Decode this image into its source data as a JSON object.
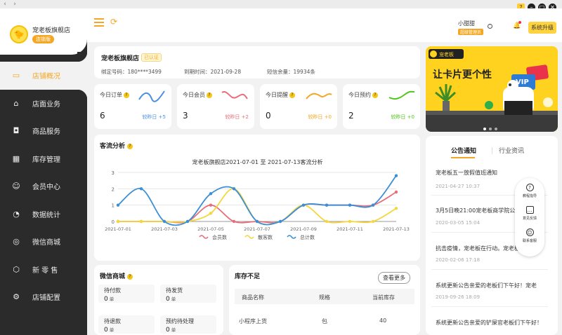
{
  "window": {
    "back": "‹",
    "forward": "›",
    "controls": [
      "?",
      "–",
      "▢",
      "✕"
    ]
  },
  "sidebar": {
    "store_name": "宠老板旗舰店",
    "badge": "连锁版",
    "items": [
      {
        "label": "店铺概况",
        "icon": "monitor-icon",
        "active": true
      },
      {
        "label": "店面业务",
        "icon": "house-icon"
      },
      {
        "label": "商品服务",
        "icon": "bag-icon"
      },
      {
        "label": "库存管理",
        "icon": "warehouse-icon"
      },
      {
        "label": "会员中心",
        "icon": "member-icon"
      },
      {
        "label": "数据统计",
        "icon": "chart-icon"
      },
      {
        "label": "微信商城",
        "icon": "wechat-icon"
      },
      {
        "label": "新 零 售",
        "icon": "box-icon"
      },
      {
        "label": "店铺配置",
        "icon": "gear-icon"
      }
    ]
  },
  "header": {
    "user_name": "小甜甜",
    "user_tag": "超级管理员",
    "upgrade": "系统升级"
  },
  "store": {
    "name": "宠老板旗舰店",
    "verified": "已认证",
    "phone": "绑定号码：180****3499",
    "expire": "到期时间：2021-09-28",
    "sms": "短信余量：19934条"
  },
  "stats": [
    {
      "label": "今日订单",
      "value": "6",
      "cmp_label": "较昨日",
      "cmp_value": "+5",
      "color": "#4a90e2"
    },
    {
      "label": "今日会员",
      "value": "3",
      "cmp_label": "较昨日",
      "cmp_value": "+2",
      "color": "#e86d7a"
    },
    {
      "label": "今日提醒",
      "value": "0",
      "cmp_label": "较昨日",
      "cmp_value": "+0",
      "color": "#f5a623"
    },
    {
      "label": "今日预约",
      "value": "2",
      "cmp_label": "较昨日",
      "cmp_value": "+0",
      "color": "#52c41a"
    }
  ],
  "traffic": {
    "title": "客流分析",
    "chart_title": "宠老板旗舰店2021-07-01 至 2021-07-13客流分析"
  },
  "chart_data": {
    "type": "line",
    "title": "宠老板旗舰店2021-07-01 至 2021-07-13客流分析",
    "x": [
      "2021-07-01",
      "2021-07-02",
      "2021-07-03",
      "2021-07-04",
      "2021-07-05",
      "2021-07-06",
      "2021-07-07",
      "2021-07-08",
      "2021-07-09",
      "2021-07-10",
      "2021-07-11",
      "2021-07-12",
      "2021-07-13"
    ],
    "x_tick_labels": [
      "2021-07-01",
      "2021-07-03",
      "2021-07-05",
      "2021-07-07",
      "2021-07-09",
      "2021-07-11",
      "2021-07-13"
    ],
    "ylim": [
      0,
      3
    ],
    "y_ticks": [
      "0",
      "1",
      "2",
      "3"
    ],
    "series": [
      {
        "name": "会员数",
        "color": "#e86d7a",
        "values": [
          0,
          0,
          0,
          0,
          1,
          0,
          0,
          0,
          1,
          1,
          1,
          1,
          1.8
        ]
      },
      {
        "name": "散客数",
        "color": "#f5d63d",
        "values": [
          0,
          0,
          0,
          0,
          0.5,
          2,
          0,
          0,
          1,
          0,
          0,
          0,
          0.8
        ]
      },
      {
        "name": "总计数",
        "color": "#3a8fd6",
        "values": [
          1,
          2,
          0,
          0,
          1.7,
          2,
          0,
          0,
          1,
          1,
          1,
          1,
          2.8
        ]
      }
    ],
    "legend": "bottom",
    "grid": true
  },
  "wechat": {
    "title": "微信商城",
    "boxes": [
      {
        "label": "待付款",
        "value": "0",
        "unit": "单"
      },
      {
        "label": "待发货",
        "value": "0",
        "unit": "单"
      },
      {
        "label": "待退款",
        "value": "0",
        "unit": "单"
      },
      {
        "label": "预约待处理",
        "value": "0",
        "unit": "单"
      }
    ]
  },
  "stock": {
    "title": "库存不足",
    "more": "查看更多",
    "headers": [
      "商品名称",
      "规格",
      "当前库存"
    ],
    "rows": [
      [
        "小程序上货",
        "包",
        "40"
      ]
    ]
  },
  "banner": {
    "logo_text": "宠老板",
    "slogan": "让卡片更个性",
    "vip": "VIP"
  },
  "notices": {
    "tabs": [
      "公告通知",
      "行业资讯"
    ],
    "items": [
      {
        "title": "宠老板五一放假值班通知",
        "date": "2021-04-27 10:37"
      },
      {
        "title": "3月5日晚21:00宠老板商学院公开",
        "date": "2020-03-05 15:04"
      },
      {
        "title": "抗击疫情，宠老板在行动。宠老板",
        "date": "2020-02-06 17:18"
      },
      {
        "title": "系统更新公告亲爱的老板们下午好！宠老",
        "date": "2019-09-26 18:09"
      },
      {
        "title": "系统更新公告亲爱的铲屎官老板们下午好！",
        "date": ""
      }
    ]
  },
  "float_bar": [
    {
      "label": "教程指导",
      "icon": "question-icon"
    },
    {
      "label": "意见反馈",
      "icon": "feedback-icon"
    },
    {
      "label": "联系客服",
      "icon": "service-icon"
    }
  ]
}
